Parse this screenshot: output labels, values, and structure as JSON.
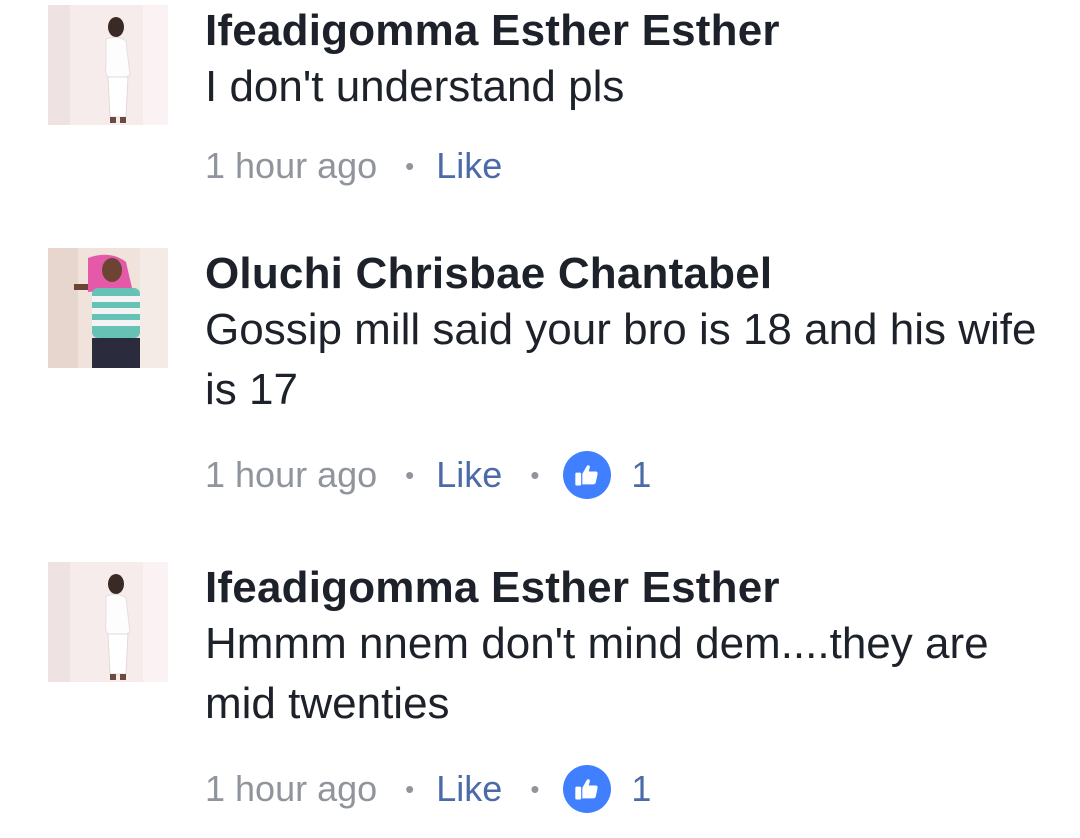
{
  "comments": [
    {
      "avatar_icon": "profile-photo-woman-white-dress",
      "author": "Ifeadigomma Esther Esther",
      "text": "I don't understand pls",
      "time": "1 hour ago",
      "separator": "•",
      "like_label": "Like"
    },
    {
      "avatar_icon": "profile-photo-woman-striped-top",
      "author": "Oluchi Chrisbae Chantabel",
      "text": "Gossip mill said your bro is 18 and his wife is 17",
      "time": "1 hour ago",
      "separator": "•",
      "like_label": "Like",
      "reaction_icon": "thumbs-up-icon",
      "reaction_count": "1"
    },
    {
      "avatar_icon": "profile-photo-woman-white-dress",
      "author": "Ifeadigomma Esther Esther",
      "text": "Hmmm nnem don't mind dem....they are mid twenties",
      "time": "1 hour ago",
      "separator": "•",
      "like_label": "Like",
      "reaction_icon": "thumbs-up-icon",
      "reaction_count": "1"
    }
  ],
  "colors": {
    "text_primary": "#1d2129",
    "text_secondary": "#90949c",
    "link": "#4b6aa8",
    "reaction_blue": "#4080ff"
  }
}
